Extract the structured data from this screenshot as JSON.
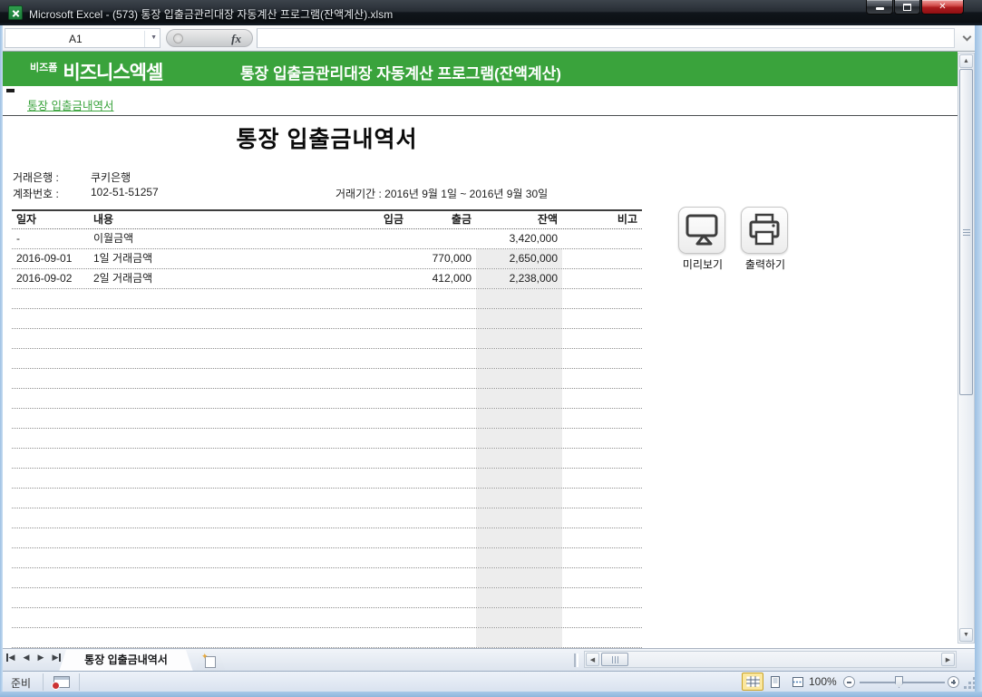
{
  "theme": {
    "green": "#3aa33c",
    "shaded_column": "#ededed",
    "selected_view_yellow": "#fbe79e",
    "close_button_red": "#ad1d1f"
  },
  "window": {
    "title": "Microsoft Excel - (573) 통장 입출금관리대장 자동계산 프로그램(잔액계산).xlsm"
  },
  "formula_bar": {
    "name_box": "A1",
    "fx": "fx",
    "formula": ""
  },
  "brand": {
    "small": "비즈폼",
    "main": "비즈니스엑셀"
  },
  "program_header": {
    "title": "통장 입출금관리대장 자동계산 프로그램(잔액계산)"
  },
  "nav_link": {
    "label": "통장 입출금내역서"
  },
  "doc": {
    "title": "통장 입출금내역서",
    "bank_label": "거래은행 :",
    "bank_value": "쿠키은행",
    "account_label": "계좌번호 :",
    "account_value": "102-51-51257",
    "period": "거래기간 : 2016년 9월 1일 ~ 2016년 9월 30일",
    "table": {
      "headers": [
        "일자",
        "내용",
        "입금",
        "출금",
        "잔액",
        "비고"
      ],
      "rows": [
        {
          "date": "-",
          "desc": "이월금액",
          "deposit": "",
          "withdraw": "",
          "balance": "3,420,000",
          "note": ""
        },
        {
          "date": "2016-09-01",
          "desc": "1일 거래금액",
          "deposit": "",
          "withdraw": "770,000",
          "balance": "2,650,000",
          "note": ""
        },
        {
          "date": "2016-09-02",
          "desc": "2일 거래금액",
          "deposit": "",
          "withdraw": "412,000",
          "balance": "2,238,000",
          "note": ""
        }
      ]
    },
    "buttons": [
      {
        "label": "미리보기",
        "icon": "monitor-icon"
      },
      {
        "label": "출력하기",
        "icon": "printer-icon"
      }
    ]
  },
  "sheet_tabs": {
    "active": "통장 입출금내역서"
  },
  "status_bar": {
    "mode": "준비",
    "zoom_level": "100%"
  },
  "icons": {
    "close": "✕",
    "name_box_arrow": "▼",
    "scroll_up": "▲",
    "scroll_down": "▼",
    "scroll_left": "◀",
    "scroll_right": "▶",
    "tab_nav_left": "◀",
    "tab_nav_right": "▶",
    "insert_sheet_star": "✦"
  }
}
